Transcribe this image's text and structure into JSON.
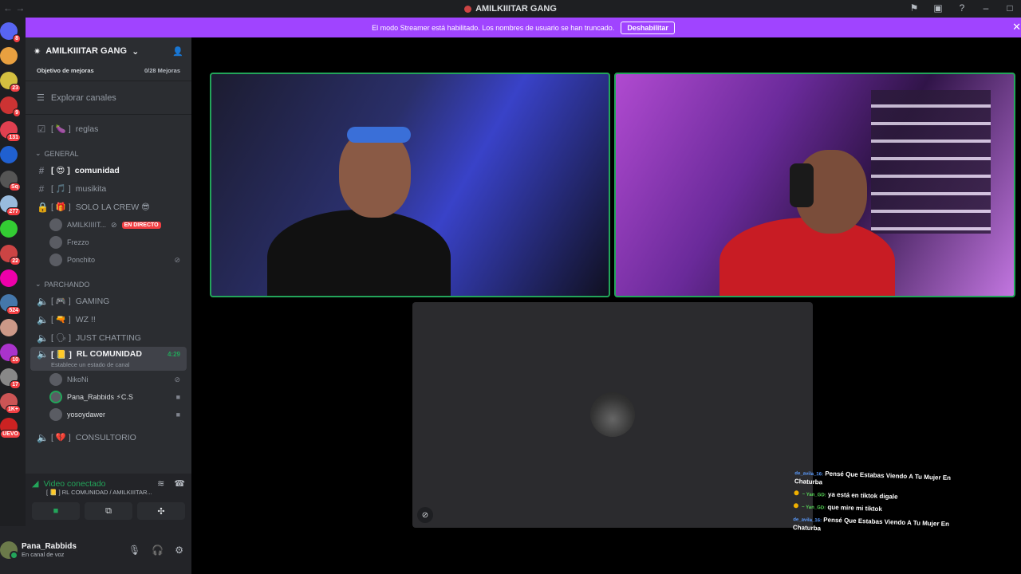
{
  "window": {
    "title": "AMILKIIITAR GANG"
  },
  "guild_rail": {
    "badges": [
      "8",
      "",
      "23",
      "9",
      "131",
      "",
      "Sq",
      "277",
      "",
      "22",
      "",
      "524",
      "",
      "10",
      "17",
      "1K+",
      "UEVO"
    ]
  },
  "banner": {
    "text": "El modo Streamer está habilitado. Los nombres de usuario se han truncado.",
    "button": "Deshabilitar"
  },
  "server": {
    "name": "AMILKIIITAR GANG",
    "boost_label": "Objetivo de mejoras",
    "boost_count": "0/28 Mejoras",
    "explore": "Explorar canales"
  },
  "channels": {
    "rules": {
      "prefix": "[ 🍆 ]",
      "name": "reglas"
    },
    "category_general": "GENERAL",
    "text": [
      {
        "prefix": "[ 😍 ]",
        "name": "comunidad"
      },
      {
        "prefix": "[ 🎵 ]",
        "name": "musikita"
      },
      {
        "prefix": "[ 🎁 ]",
        "name": "SOLO LA CREW 😎"
      }
    ],
    "crew_users": [
      {
        "name": "AMILKIIIIT...",
        "badge": "EN DIRECTO"
      },
      {
        "name": "Frezzo"
      },
      {
        "name": "Ponchito"
      }
    ],
    "category_parchando": "PARCHANDO",
    "voice": [
      {
        "prefix": "[ 🎮 ]",
        "name": "GAMING"
      },
      {
        "prefix": "[ 🔫 ]",
        "name": "WZ !!"
      },
      {
        "prefix": "[ 🗣 ]",
        "name": "JUST CHATTING"
      }
    ],
    "active_voice": {
      "prefix": "[ 📒 ]",
      "name": "RL COMUNIDAD",
      "time": "4:29",
      "sub": "Establece un estado de canal"
    },
    "active_users": [
      {
        "name": "NikoNi"
      },
      {
        "name": "Pana_Rabbids ⚡C.S"
      },
      {
        "name": "yosoydawer"
      }
    ],
    "last_voice": {
      "prefix": "[ 💔 ]",
      "name": "CONSULTORIO"
    }
  },
  "voice_panel": {
    "status": "Video conectado",
    "channel": "[ 📒 ] RL COMUNIDAD / AMILKIIITAR..."
  },
  "user": {
    "name": "Pana_Rabbids",
    "status": "En canal de voz"
  },
  "chat": [
    {
      "user": "de_avila_16:",
      "text": "Pensé Que Estabas Viendo A Tu Mujer En Chaturba"
    },
    {
      "user": "~ Yan_GD:",
      "text": "ya está en tiktok digale"
    },
    {
      "user": "~ Yan_GD:",
      "text": "que mire mi tiktok"
    },
    {
      "user": "de_avila_16:",
      "text": "Pensé Que Estabas Viendo A Tu Mujer En Chaturba"
    }
  ],
  "colors": {
    "accent": "#a044ff",
    "speaking": "#23a55a",
    "live": "#f23f43"
  }
}
